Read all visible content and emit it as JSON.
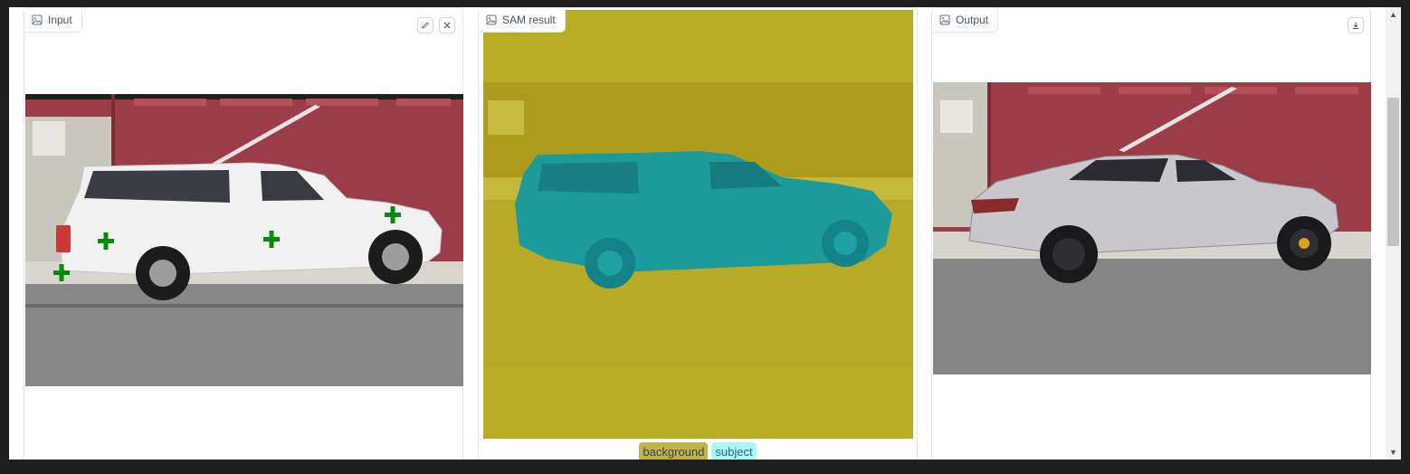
{
  "panels": {
    "input": {
      "label": "Input",
      "icon": "image-icon",
      "tools": [
        "edit-icon",
        "close-icon"
      ]
    },
    "sam": {
      "label": "SAM result",
      "icon": "image-icon"
    },
    "output": {
      "label": "Output",
      "icon": "image-icon",
      "tools": [
        "download-icon"
      ]
    }
  },
  "legend": {
    "background_label": "background",
    "subject_label": "subject",
    "background_color": "#c0b34a",
    "subject_color": "#aef5f5"
  },
  "colors": {
    "mask_background": "#b9ad26",
    "mask_subject": "#1d9a9a",
    "point_marker": "#0a8a0a",
    "wall_red": "#9a3d48"
  }
}
